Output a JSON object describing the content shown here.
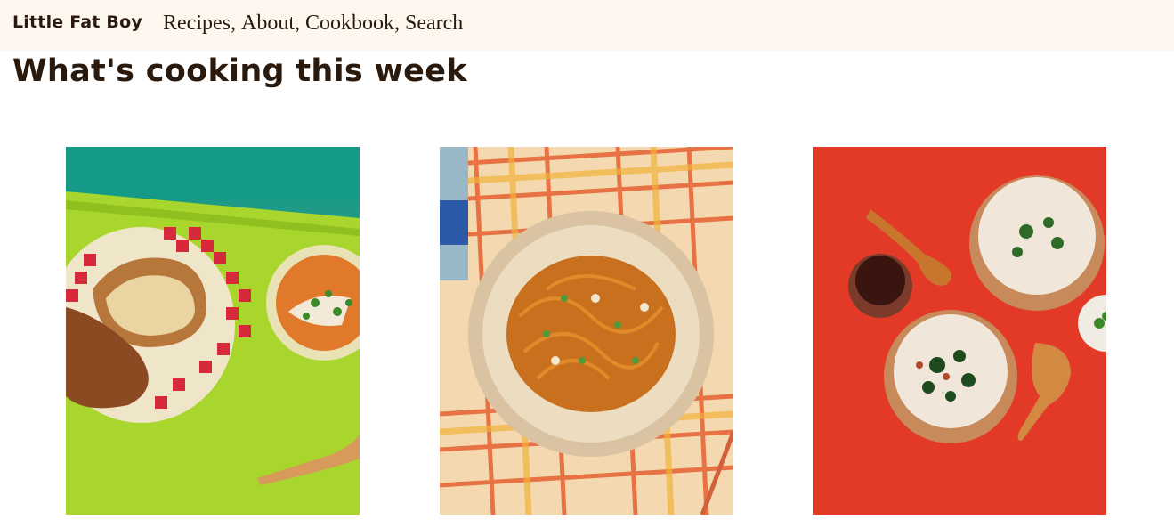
{
  "header": {
    "brand": "Little Fat Boy",
    "nav": [
      {
        "label": "Recipes"
      },
      {
        "label": "About"
      },
      {
        "label": "Cookbook"
      },
      {
        "label": "Search"
      }
    ],
    "separator": ","
  },
  "main": {
    "title": "What's cooking this week",
    "cards": [
      {
        "image": "grilled-cheese-tomato-soup-photo",
        "bg": "#a6d52b"
      },
      {
        "image": "noodles-on-plaid-tablecloth-photo",
        "bg": "#f0b47a"
      },
      {
        "image": "congee-bowls-on-red-photo",
        "bg": "#e63a26"
      }
    ]
  },
  "colors": {
    "topbar_bg": "#fdf7ef",
    "text": "#2a1a0e"
  }
}
